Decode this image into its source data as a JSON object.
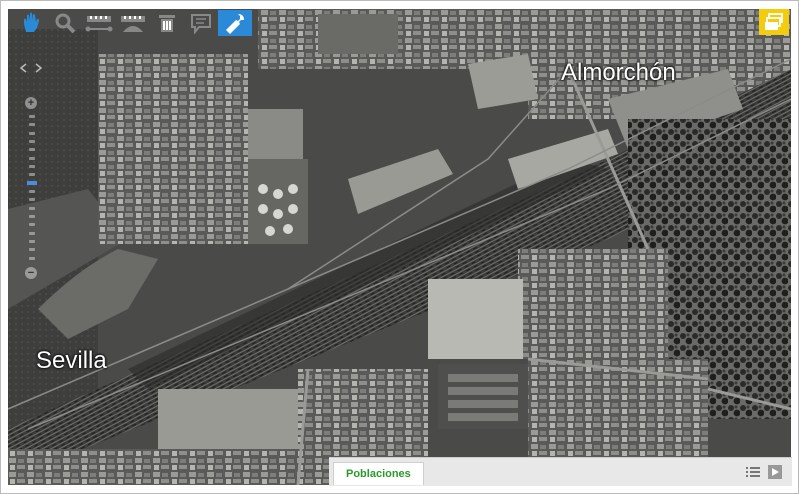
{
  "toolbar": {
    "tools": [
      {
        "name": "pan-hand-icon",
        "active": false
      },
      {
        "name": "zoom-search-icon",
        "active": false
      },
      {
        "name": "measure-distance-icon",
        "active": false
      },
      {
        "name": "measure-area-icon",
        "active": false
      },
      {
        "name": "delete-trash-icon",
        "active": false
      },
      {
        "name": "comment-icon",
        "active": false
      },
      {
        "name": "wrench-tools-icon",
        "active": true
      }
    ]
  },
  "layers_button": {
    "icon": "layers-icon",
    "color": "#f3cc10"
  },
  "map": {
    "labels": {
      "almorchon": "Almorchón",
      "sevilla": "Sevilla"
    }
  },
  "zoom": {
    "plus": "+",
    "minus": "−",
    "level": 0.55
  },
  "bottom_panel": {
    "tab_label": "Poblaciones",
    "list_icon": "list-icon",
    "play_icon": "play-icon"
  },
  "colors": {
    "accent": "#2a8ad8",
    "tab_text": "#2a9a2a"
  }
}
